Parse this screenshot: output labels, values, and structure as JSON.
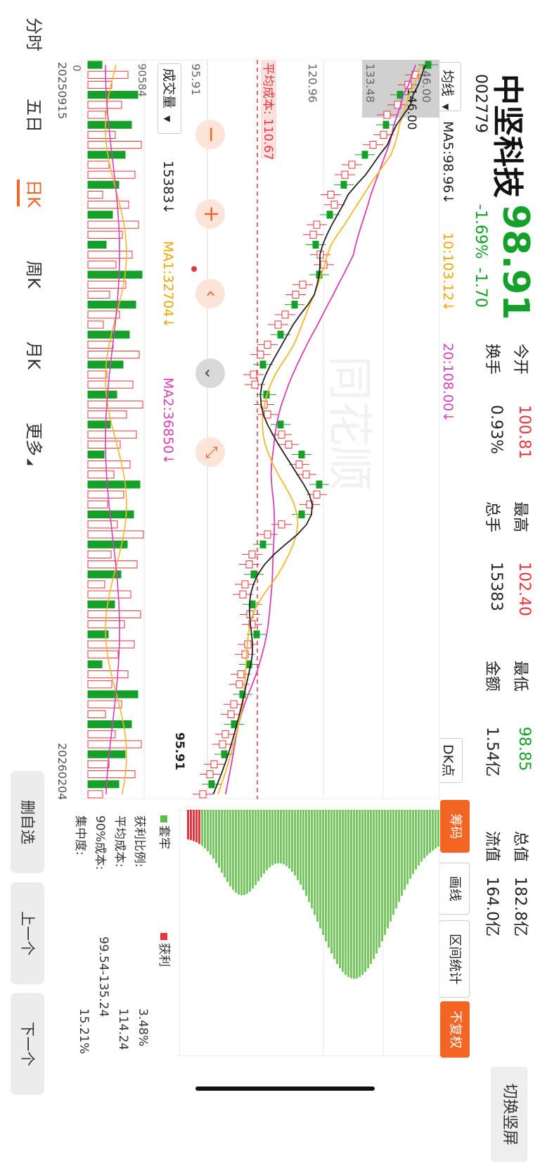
{
  "stock": {
    "name": "中坚科技",
    "code": "002779",
    "price": "98.91",
    "change_pct": "-1.69%",
    "change": "-1.70"
  },
  "stats": {
    "open_label": "今开",
    "open": "100.81",
    "high_label": "最高",
    "high": "102.40",
    "low_label": "最低",
    "low": "98.85",
    "mcap_label": "总值",
    "mcap": "182.8亿",
    "turnover_label": "换手",
    "turnover": "0.93%",
    "volume_label": "总手",
    "volume": "15383",
    "amount_label": "金额",
    "amount": "1.54亿",
    "float_label": "流值",
    "float_cap": "164.0亿"
  },
  "toolbar": {
    "switch_label": "切换竖屏",
    "ma_selector": "均线",
    "dk_label": "DK点",
    "chips_label": "筹码",
    "draw_label": "画线",
    "range_stats_label": "区间统计",
    "adjust_label": "不复权"
  },
  "legend": {
    "ma5": "MA5:98.96↓",
    "ma10": "10:103.12↓",
    "ma20": "20:108.00↓",
    "vol_selector": "成交量",
    "vol": "15383↓",
    "vol_ma1": "MA1:32704↓",
    "vol_ma2": "MA2:36850↓"
  },
  "chart_labels": {
    "y_high": "146.00",
    "y_mid_high": "133.48",
    "y_mid": "120.96",
    "y_low": "95.91",
    "max_marker": "146.00",
    "min_marker": "95.91",
    "avg_cost_line": "平均成本: 110.67",
    "vol_max": "90584",
    "vol_zero": "0",
    "date_start": "20250915",
    "date_end": "20260204"
  },
  "chips": {
    "legend_trapped": "套牢",
    "legend_profit": "获利",
    "profit_ratio_label": "获利比例:",
    "profit_ratio": "3.48%",
    "avg_cost_label": "平均成本:",
    "avg_cost": "114.24",
    "cost90_label": "90%成本:",
    "cost90": "99.54-135.24",
    "concentration_label": "集中度:",
    "concentration": "15.21%"
  },
  "tabs": [
    "分时",
    "五日",
    "日K",
    "周K",
    "月K",
    "更多"
  ],
  "active_tab": "日K",
  "side_buttons": [
    "删自选",
    "上一个",
    "下一个"
  ],
  "colors": {
    "up": "#e8343b",
    "down": "#15a02a",
    "ma5": "#222222",
    "ma10": "#f7b62b",
    "ma20": "#d83fb8",
    "accent": "#f26522"
  },
  "chart_data": {
    "type": "candlestick",
    "x_start": "20250915",
    "x_end": "20260204",
    "ylim": [
      95.91,
      146.0
    ],
    "series": [
      {
        "name": "MA5",
        "last": 98.96
      },
      {
        "name": "10",
        "last": 103.12
      },
      {
        "name": "20",
        "last": 108.0
      }
    ],
    "volume": {
      "max": 90584,
      "last": 15383,
      "ma1": 32704,
      "ma2": 36850
    }
  }
}
